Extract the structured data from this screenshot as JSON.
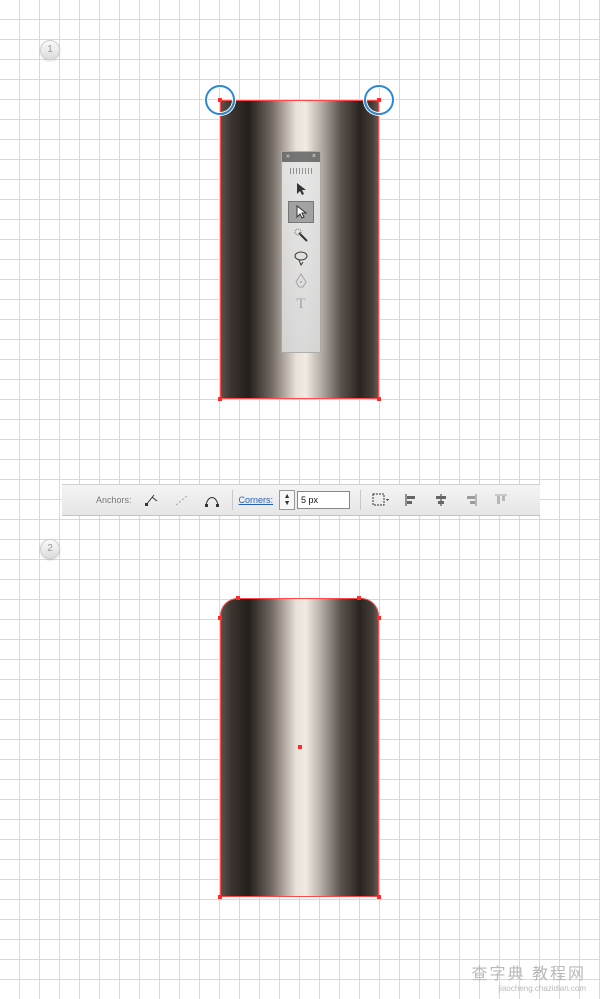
{
  "steps": [
    {
      "number": "1"
    },
    {
      "number": "2"
    }
  ],
  "tools_panel": {
    "tools": [
      {
        "icon": "selection-arrow-icon"
      },
      {
        "icon": "direct-selection-arrow-icon",
        "active": true
      },
      {
        "icon": "magic-wand-icon"
      },
      {
        "icon": "lasso-icon"
      },
      {
        "icon": "pen-icon"
      },
      {
        "icon": "type-icon",
        "glyph": "T"
      }
    ]
  },
  "control_bar": {
    "anchors_label": "Anchors:",
    "corners_label": "Corners:",
    "corners_value": "5 px"
  },
  "colors": {
    "selection_red": "#ff2a2a",
    "highlight_blue": "#2b88d8"
  },
  "watermark": {
    "main": "查字典 教程网",
    "sub": "jiaocheng.chazidian.com"
  }
}
